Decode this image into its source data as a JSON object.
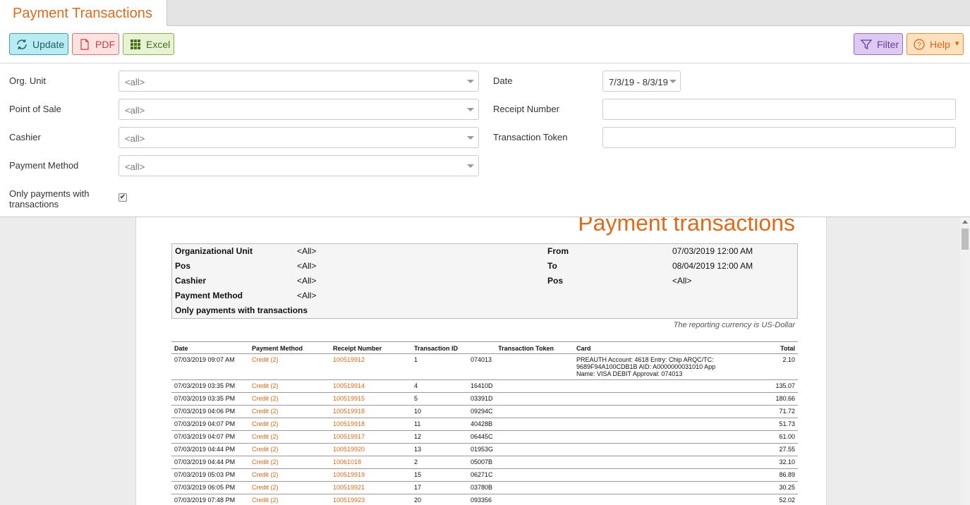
{
  "tab": {
    "title": "Payment Transactions"
  },
  "toolbar": {
    "update": "Update",
    "pdf": "PDF",
    "excel": "Excel",
    "filter": "Filter",
    "help": "Help"
  },
  "form": {
    "org_unit_label": "Org. Unit",
    "org_unit_value": "<all>",
    "pos_label": "Point of Sale",
    "pos_value": "<all>",
    "cashier_label": "Cashier",
    "cashier_value": "<all>",
    "payment_method_label": "Payment Method",
    "payment_method_value": "<all>",
    "only_payments_label": "Only payments with transactions",
    "only_payments_checked": "✔",
    "date_label": "Date",
    "date_value": "7/3/19 - 8/3/19",
    "receipt_label": "Receipt Number",
    "receipt_value": "",
    "token_label": "Transaction Token",
    "token_value": ""
  },
  "report": {
    "title": "Payment transactions",
    "summary": {
      "org_unit_k": "Organizational Unit",
      "org_unit_v": "<All>",
      "pos_k": "Pos",
      "pos_v": "<All>",
      "cashier_k": "Cashier",
      "cashier_v": "<All>",
      "payment_method_k": "Payment Method",
      "payment_method_v": "<All>",
      "only_payments_k": "Only payments with transactions",
      "from_k": "From",
      "from_v": "07/03/2019 12:00 AM",
      "to_k": "To",
      "to_v": "08/04/2019 12:00 AM",
      "pos2_k": "Pos",
      "pos2_v": "<All>"
    },
    "currency_note": "The reporting currency is US-Dollar",
    "columns": [
      "Date",
      "Payment Method",
      "Receipt Number",
      "Transaction ID",
      "Transaction Token",
      "Card",
      "Total"
    ],
    "rows": [
      {
        "date": "07/03/2019 09:07 AM",
        "method": "Credit (2)",
        "receipt": "100519912",
        "id": "1",
        "token": "074013",
        "card": "PREAUTH Account: 4618 Entry: Chip ARQC/TC: 9689F94A100CDB1B AID: A0000000031010 App Name: VISA DEBIT Approval: 074013",
        "total": "2.10"
      },
      {
        "date": "07/03/2019 03:35 PM",
        "method": "Credit (2)",
        "receipt": "100519914",
        "id": "4",
        "token": "16410D",
        "card": "",
        "total": "135.07"
      },
      {
        "date": "07/03/2019 03:35 PM",
        "method": "Credit (2)",
        "receipt": "100519915",
        "id": "5",
        "token": "03391D",
        "card": "",
        "total": "180.66"
      },
      {
        "date": "07/03/2019 04:06 PM",
        "method": "Credit (2)",
        "receipt": "100519918",
        "id": "10",
        "token": "09294C",
        "card": "",
        "total": "71.72"
      },
      {
        "date": "07/03/2019 04:07 PM",
        "method": "Credit (2)",
        "receipt": "100519918",
        "id": "11",
        "token": "40428B",
        "card": "",
        "total": "51.73"
      },
      {
        "date": "07/03/2019 04:07 PM",
        "method": "Credit (2)",
        "receipt": "100519917",
        "id": "12",
        "token": "06445C",
        "card": "",
        "total": "61.00"
      },
      {
        "date": "07/03/2019 04:44 PM",
        "method": "Credit (2)",
        "receipt": "100519920",
        "id": "13",
        "token": "01953G",
        "card": "",
        "total": "27.55"
      },
      {
        "date": "07/03/2019 04:44 PM",
        "method": "Credit (2)",
        "receipt": "10061018",
        "id": "2",
        "token": "05007B",
        "card": "",
        "total": "32.10"
      },
      {
        "date": "07/03/2019 05:03 PM",
        "method": "Credit (2)",
        "receipt": "100519919",
        "id": "15",
        "token": "06271C",
        "card": "",
        "total": "86.89"
      },
      {
        "date": "07/03/2019 06:05 PM",
        "method": "Credit (2)",
        "receipt": "100519921",
        "id": "17",
        "token": "03780B",
        "card": "",
        "total": "30.25"
      },
      {
        "date": "07/03/2019 07:48 PM",
        "method": "Credit (2)",
        "receipt": "100519923",
        "id": "20",
        "token": "093356",
        "card": "",
        "total": "52.02"
      }
    ]
  },
  "colors": {
    "accent": "#e06a1b"
  }
}
